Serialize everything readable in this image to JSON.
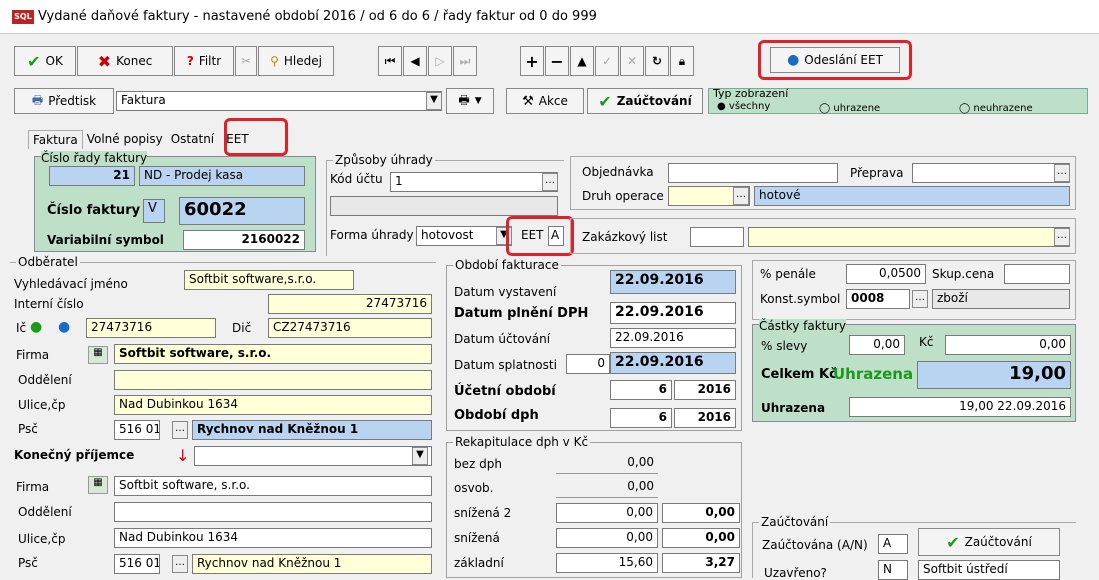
{
  "window": {
    "title": "Vydané daňové faktury - nastavené období 2016 / od 6 do 6 / řady faktur od 0 do 999",
    "icon": "sql-app-icon"
  },
  "toolbar": {
    "ok": "OK",
    "konec": "Konec",
    "filtr": "Filtr",
    "hledej": "Hledej",
    "odeslani": "Odeslání EET"
  },
  "toolbar2": {
    "predtisk": "Předtisk",
    "template": "Faktura",
    "akce": "Akce",
    "zauctovani": "Zaúčtování",
    "typ_label": "Typ zobrazení",
    "typ_vse": "všechny",
    "typ_uhr": "uhrazene",
    "typ_neuhr": "neuhrazene"
  },
  "tabs": [
    "Faktura",
    "Volné popisy",
    "Ostatní",
    "EET"
  ],
  "cislo_rady": {
    "legend": "Číslo řady faktury",
    "number": "21",
    "name": "ND - Prodej kasa",
    "cislo_label": "Číslo faktury",
    "cislo_prefix": "V",
    "cislo": "60022",
    "vs_label": "Variabilní symbol",
    "vs": "2160022"
  },
  "zpusoby": {
    "legend": "Způsoby úhrady",
    "kod_label": "Kód účtu",
    "kod": "1",
    "forma_label": "Forma úhrady",
    "forma": "hotovost",
    "eet_label": "EET",
    "eet": "A"
  },
  "obj": {
    "objednavka_label": "Objednávka",
    "preprava_label": "Přeprava",
    "druh_label": "Druh operace",
    "druh": "hotové",
    "zakazkovy_label": "Zakázkový list"
  },
  "odberatel": {
    "legend": "Odběratel",
    "vyhl_label": "Vyhledávací jméno",
    "vyhl": "Softbit software,s.r.o.",
    "interni_label": "Interní číslo",
    "interni": "27473716",
    "ic_label": "Ič",
    "ic": "27473716",
    "dic_label": "Dič",
    "dic": "CZ27473716",
    "firma_label": "Firma",
    "firma": "Softbit software, s.r.o.",
    "oddeleni_label": "Oddělení",
    "ulice_label": "Ulice,čp",
    "ulice": "Nad Dubinkou 1634",
    "psc_label": "Psč",
    "psc": "516 01",
    "mesto": "Rychnov nad Kněžnou 1"
  },
  "prijemce": {
    "label": "Konečný příjemce",
    "firma_label": "Firma",
    "firma": "Softbit software, s.r.o.",
    "oddeleni_label": "Oddělení",
    "ulice_label": "Ulice,čp",
    "ulice": "Nad Dubinkou 1634",
    "psc_label": "Psč",
    "psc": "516 01",
    "mesto": "Rychnov nad Kněžnou 1"
  },
  "obdobi": {
    "legend": "Období fakturace",
    "vystaveni_label": "Datum vystavení",
    "vystaveni": "22.09.2016",
    "plneni_label": "Datum plnění DPH",
    "plneni": "22.09.2016",
    "uctovani_label": "Datum účtování",
    "uctovani": "22.09.2016",
    "splatnosti_label": "Datum splatnosti",
    "splatnosti_days": "0",
    "splatnosti": "22.09.2016",
    "ucetni_label": "Účetní období",
    "ucetni_m": "6",
    "ucetni_y": "2016",
    "dph_label": "Období dph",
    "dph_m": "6",
    "dph_y": "2016"
  },
  "rekap": {
    "legend": "Rekapitulace dph v Kč",
    "rows": [
      {
        "label": "bez dph",
        "base": "0,00",
        "tax": ""
      },
      {
        "label": "osvob.",
        "base": "0,00",
        "tax": ""
      },
      {
        "label": "snížená 2",
        "base": "0,00",
        "tax": "0,00"
      },
      {
        "label": "snížená",
        "base": "0,00",
        "tax": "0,00"
      },
      {
        "label": "základní",
        "base": "15,60",
        "tax": "3,27"
      }
    ]
  },
  "penale": {
    "penale_label": "% penále",
    "penale": "0,0500",
    "skup_label": "Skup.cena",
    "konst_label": "Konst.symbol",
    "konst": "0008",
    "konst_name": "zboží"
  },
  "castky": {
    "legend": "Částky faktury",
    "slevy_label": "% slevy",
    "slevy": "0,00",
    "kc_label": "Kč",
    "kc": "0,00",
    "celkem_label": "Celkem Kč",
    "status": "Uhrazena",
    "celkem": "19,00",
    "uhr_label": "Uhrazena",
    "uhr": "19,00 22.09.2016"
  },
  "zauct": {
    "legend": "Zaúčtování",
    "zauctovana_label": "Zaúčtována (A/N)",
    "zauctovana": "A",
    "button": "Zaúčtování",
    "uzavreno_label": "Uzavřeno?",
    "uzavreno": "N",
    "ustredi": "Softbit ústředí"
  },
  "colors": {
    "highlight": "#e0202a",
    "blue_field": "#b8d4f0",
    "yellow_field": "#ffffd8",
    "green_panel": "#bfe0c8",
    "status_green": "#1a9a1a"
  }
}
